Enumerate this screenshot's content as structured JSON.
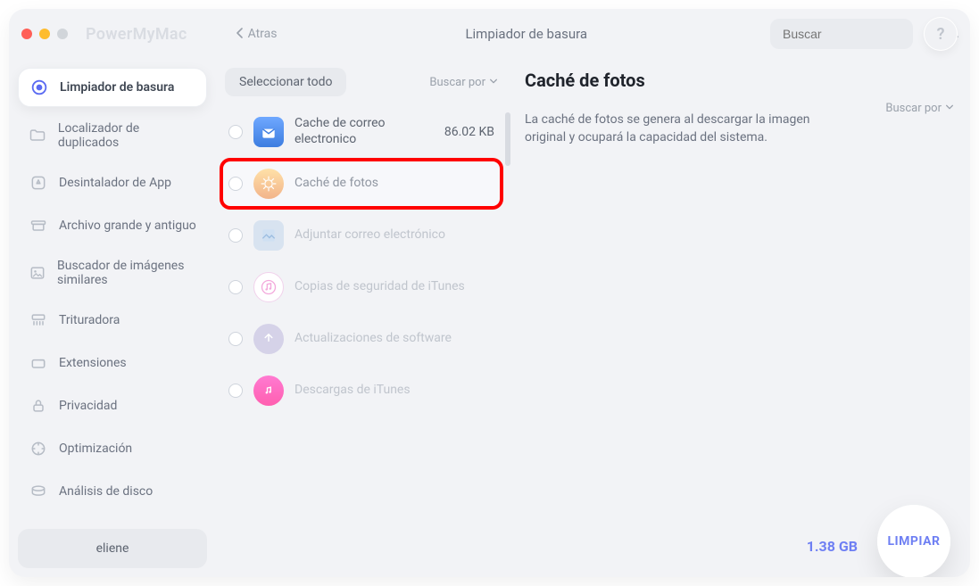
{
  "app_name": "PowerMyMac",
  "back_label": "Atras",
  "header_title": "Limpiador de basura",
  "search_placeholder": "Buscar",
  "help_glyph": "?",
  "sidebar": {
    "items": [
      {
        "label": "Limpiador de basura",
        "icon": "target"
      },
      {
        "label": "Localizador de duplicados",
        "icon": "folder"
      },
      {
        "label": "Desintalador de App",
        "icon": "app"
      },
      {
        "label": "Archivo grande y antiguo",
        "icon": "archive"
      },
      {
        "label": "Buscador de imágenes similares",
        "icon": "image"
      },
      {
        "label": "Trituradora",
        "icon": "shredder"
      },
      {
        "label": "Extensiones",
        "icon": "extensions"
      },
      {
        "label": "Privacidad",
        "icon": "lock"
      },
      {
        "label": "Optimización",
        "icon": "optimize"
      },
      {
        "label": "Análisis de disco",
        "icon": "disk"
      }
    ],
    "user": "eliene"
  },
  "middle": {
    "select_all": "Seleccionar todo",
    "sort_label": "Buscar por",
    "categories": [
      {
        "label": "Cache de correo electronico",
        "size": "86.02 KB",
        "icon": "mail"
      },
      {
        "label": "Caché de fotos",
        "size": "",
        "icon": "photo",
        "selected": true,
        "highlighted": true
      },
      {
        "label": "Adjuntar correo electrónico",
        "size": "",
        "icon": "attach",
        "dim": true
      },
      {
        "label": "Copias de seguridad de iTunes",
        "size": "",
        "icon": "itunesbk",
        "dim": true
      },
      {
        "label": "Actualizaciones de software",
        "size": "",
        "icon": "software",
        "dim": true
      },
      {
        "label": "Descargas de iTunes",
        "size": "",
        "icon": "itunesdl",
        "dim": true
      }
    ]
  },
  "detail": {
    "title": "Caché de fotos",
    "description": "La caché de fotos se genera al descargar la imagen original y ocupará la capacidad del sistema.",
    "sort_label": "Buscar por"
  },
  "footer": {
    "total": "1.38 GB",
    "clean": "LIMPIAR"
  }
}
